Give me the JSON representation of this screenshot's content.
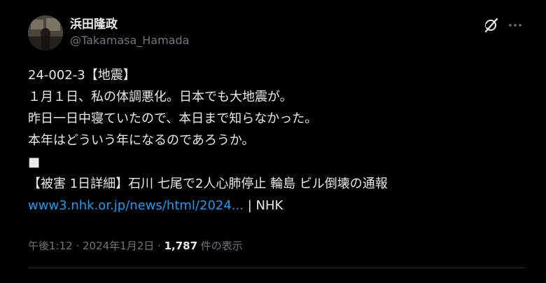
{
  "author": {
    "display_name": "浜田隆政",
    "handle": "@Takamasa_Hamada"
  },
  "icons": {
    "grok": "grok-icon",
    "more": "more-options-icon",
    "avatar": "avatar"
  },
  "tweet": {
    "lines": [
      "24-002-3【地震】",
      "１月１日、私の体調悪化。日本でも大地震が。",
      "昨日一日中寝ていたので、本日まで知らなかった。",
      "本年はどういう年になるのであろうか。",
      "■",
      "【被害 1日詳細】石川 七尾で2人心肺停止 輪島 ビル倒壊の通報"
    ],
    "link_text": "www3.nhk.or.jp/news/html/2024...",
    "link_suffix": " | NHK"
  },
  "meta": {
    "time": "午後1:12",
    "separator": " · ",
    "date": "2024年1月2日",
    "views_count": "1,787",
    "views_label": " 件の表示"
  },
  "colors": {
    "background": "#000000",
    "text": "#e7e9ea",
    "secondary": "#71767b",
    "link": "#1d9bf0",
    "divider": "#2f3336"
  }
}
